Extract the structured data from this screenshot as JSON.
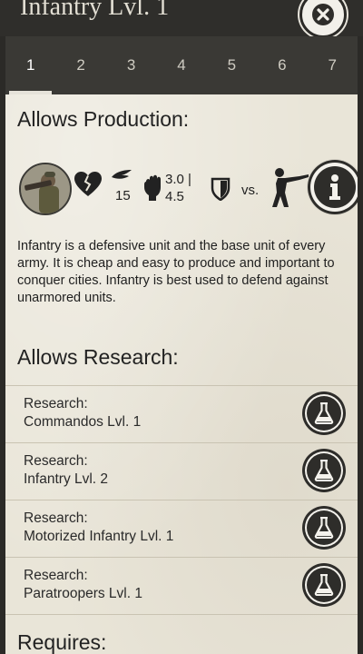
{
  "header": {
    "title": "Infantry Lvl. 1"
  },
  "tabs": [
    "1",
    "2",
    "3",
    "4",
    "5",
    "6",
    "7"
  ],
  "active_tab": "1",
  "production": {
    "heading": "Allows Production:",
    "speed": "15",
    "attack_line1": "3.0 |",
    "attack_line2": "4.5",
    "vs_label": "vs.",
    "description": "Infantry is a defensive unit and the base unit of every army. It is cheap and easy to produce and important to conquer cities. Infantry is best used to defend against unarmored units."
  },
  "research": {
    "heading": "Allows Research:",
    "items": [
      {
        "label": "Research:",
        "name": "Commandos Lvl. 1"
      },
      {
        "label": "Research:",
        "name": "Infantry Lvl. 2"
      },
      {
        "label": "Research:",
        "name": "Motorized Infantry Lvl. 1"
      },
      {
        "label": "Research:",
        "name": "Paratroopers Lvl. 1"
      }
    ]
  },
  "requires": {
    "heading": "Requires:"
  },
  "icons": {
    "close": "close-icon",
    "health": "broken-heart-icon",
    "speed": "wing-icon",
    "attack": "fist-icon",
    "armor": "shield-icon",
    "target": "infantry-soldier-icon",
    "info": "info-icon",
    "research": "flask-icon"
  },
  "colors": {
    "header_bg": "#2f2e2b",
    "tab_bar_bg": "#3a3935",
    "panel_bg": "#e9e5d8",
    "icon_dark": "#2e2d2a"
  }
}
